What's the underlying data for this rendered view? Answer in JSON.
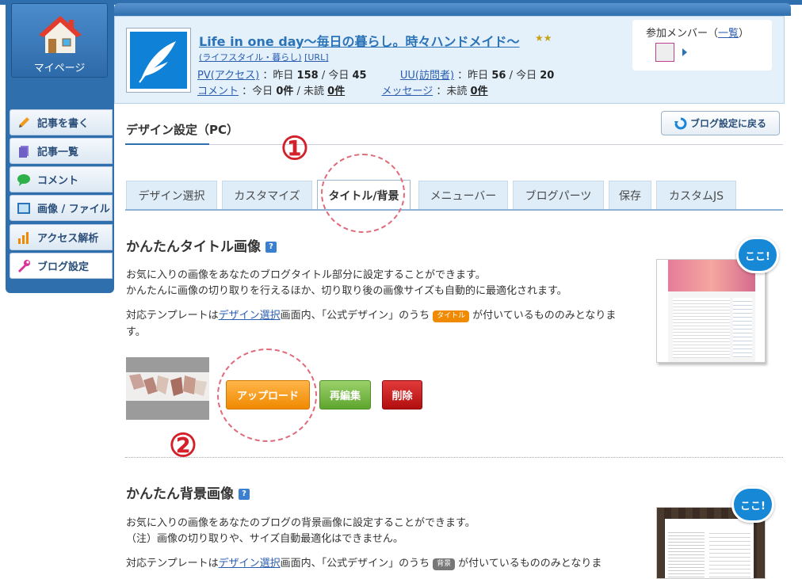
{
  "sidebar": {
    "mypage_label": "マイページ",
    "items": [
      {
        "label": "記事を書く",
        "icon": "pencil-icon"
      },
      {
        "label": "記事一覧",
        "icon": "document-icon"
      },
      {
        "label": "コメント",
        "icon": "speech-bubble-icon"
      },
      {
        "label": "画像 / ファイル",
        "icon": "image-file-icon"
      },
      {
        "label": "アクセス解析",
        "icon": "bar-chart-icon"
      },
      {
        "label": "ブログ設定",
        "icon": "wrench-icon"
      }
    ],
    "active_index": 5
  },
  "header": {
    "blog_title": "Life in one day～毎日の暮らし。時々ハンドメイド～",
    "stars": "★★",
    "category": "(ライフスタイル・暮らし)",
    "url_label": "[URL]",
    "pv_label": "PV(アクセス)",
    "pv_yesterday_label": "：昨日",
    "pv_yesterday": "158",
    "pv_today_label": "/ 今日",
    "pv_today": "45",
    "uu_label": "UU(訪問者)",
    "uu_yesterday_label": "：昨日",
    "uu_yesterday": "56",
    "uu_today_label": "/ 今日",
    "uu_today": "20",
    "comment_label": "コメント",
    "comment_today_label": "：今日",
    "comment_today": "0件",
    "comment_unread_label": "/ 未読",
    "comment_unread": "0件",
    "message_label": "メッセージ",
    "message_unread_label": "：未読",
    "message_unread": "0件",
    "members_label": "参加メンバー（",
    "members_list_link": "一覧",
    "members_close": "）"
  },
  "main": {
    "page_title": "デザイン設定（PC）",
    "back_button": "ブログ設定に戻る",
    "tabs": [
      "デザイン選択",
      "カスタマイズ",
      "タイトル/背景",
      "メニューバー",
      "ブログパーツ",
      "保存",
      "カスタムJS"
    ],
    "active_tab": 2,
    "title_section": {
      "heading": "かんたんタイトル画像",
      "help": "?",
      "line1": "お気に入りの画像をあなたのブログタイトル部分に設定することができます。",
      "line2": "かんたんに画像の切り取りを行えるほか、切り取り後の画像サイズも自動的に最適化されます。",
      "tmpl_prefix": "対応テンプレートは",
      "tmpl_link": "デザイン選択",
      "tmpl_middle": "画面内、「公式デザイン」のうち",
      "tmpl_badge": "タイトル",
      "tmpl_suffix": "が付いているもののみとなりま",
      "tmpl_suffix2": "す。",
      "upload_button": "アップロード",
      "reedit_button": "再編集",
      "delete_button": "削除",
      "preview_callout": "ここ!"
    },
    "bg_section": {
      "heading": "かんたん背景画像",
      "help": "?",
      "line1": "お気に入りの画像をあなたのブログの背景画像に設定することができます。",
      "line2": "（注）画像の切り取りや、サイズ自動最適化はできません。",
      "tmpl_prefix": "対応テンプレートは",
      "tmpl_link": "デザイン選択",
      "tmpl_middle": "画面内、「公式デザイン」のうち",
      "tmpl_badge": "背景",
      "tmpl_suffix": "が付いているもののみとなりま",
      "preview_callout": "ここ!"
    }
  },
  "annotations": {
    "one": "①",
    "two": "②"
  },
  "colors": {
    "sidebar_blue": "#2f6fae",
    "link_blue": "#2a5db0",
    "badge_orange": "#f08a00",
    "badge_gray": "#777777",
    "annotation_red": "#d4202a"
  }
}
